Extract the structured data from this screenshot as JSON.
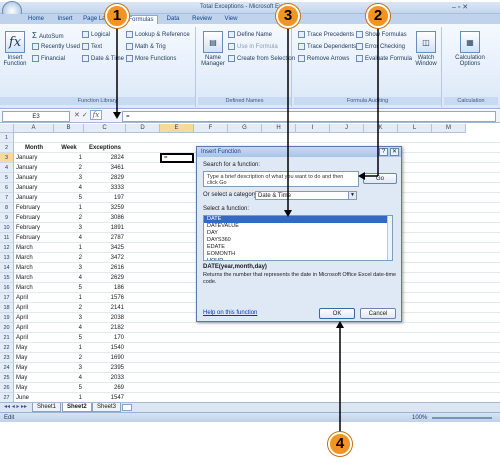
{
  "window": {
    "title": "Total Exceptions - Microsoft Excel"
  },
  "ribbon_tabs": [
    "Home",
    "Insert",
    "Page Layout",
    "Formulas",
    "Data",
    "Review",
    "View"
  ],
  "active_tab": "Formulas",
  "ribbon": {
    "insert_function": "Insert Function",
    "library": {
      "autosum": "AutoSum",
      "recently_used": "Recently Used",
      "financial": "Financial",
      "logical": "Logical",
      "text": "Text",
      "date_time": "Date & Time",
      "lookup": "Lookup & Reference",
      "math": "Math & Trig",
      "more": "More Functions",
      "label": "Function Library"
    },
    "names": {
      "manager": "Name Manager",
      "define": "Define Name",
      "use_in_formula": "Use in Formula",
      "create": "Create from Selection",
      "label": "Defined Names"
    },
    "auditing": {
      "trace_precedents": "Trace Precedents",
      "trace_dependents": "Trace Dependents",
      "remove_arrows": "Remove Arrows",
      "show_formulas": "Show Formulas",
      "error_checking": "Error Checking",
      "evaluate": "Evaluate Formula",
      "watch": "Watch Window",
      "label": "Formula Auditing"
    },
    "calculation": {
      "options": "Calculation Options",
      "label": "Calculation"
    }
  },
  "formula_bar": {
    "name_box": "E3",
    "content": "="
  },
  "columns": [
    "A",
    "B",
    "C",
    "D",
    "E",
    "F",
    "G",
    "H",
    "I",
    "J",
    "K",
    "L",
    "M"
  ],
  "headers": {
    "month": "Month",
    "week": "Week",
    "exceptions": "Exceptions"
  },
  "rows": [
    [
      "January",
      "1",
      "2824"
    ],
    [
      "January",
      "2",
      "3461"
    ],
    [
      "January",
      "3",
      "2829"
    ],
    [
      "January",
      "4",
      "3333"
    ],
    [
      "January",
      "5",
      "197"
    ],
    [
      "February",
      "1",
      "3259"
    ],
    [
      "February",
      "2",
      "3086"
    ],
    [
      "February",
      "3",
      "1891"
    ],
    [
      "February",
      "4",
      "2787"
    ],
    [
      "March",
      "1",
      "3425"
    ],
    [
      "March",
      "2",
      "3472"
    ],
    [
      "March",
      "3",
      "2616"
    ],
    [
      "March",
      "4",
      "2629"
    ],
    [
      "March",
      "5",
      "186"
    ],
    [
      "April",
      "1",
      "1576"
    ],
    [
      "April",
      "2",
      "2141"
    ],
    [
      "April",
      "3",
      "2038"
    ],
    [
      "April",
      "4",
      "2182"
    ],
    [
      "April",
      "5",
      "170"
    ],
    [
      "May",
      "1",
      "1540"
    ],
    [
      "May",
      "2",
      "1690"
    ],
    [
      "May",
      "3",
      "2395"
    ],
    [
      "May",
      "4",
      "2033"
    ],
    [
      "May",
      "5",
      "269"
    ],
    [
      "June",
      "1",
      "1547"
    ]
  ],
  "active_cell_value": "=",
  "sheets": [
    "Sheet1",
    "Sheet2",
    "Sheet3"
  ],
  "active_sheet": "Sheet2",
  "status": {
    "mode": "Edit",
    "zoom": "100%"
  },
  "dialog": {
    "title": "Insert Function",
    "search_label": "Search for a function:",
    "search_text": "Type a brief description of what you want to do and then click Go",
    "go": "Go",
    "category_label": "Or select a category:",
    "category": "Date & Time",
    "select_label": "Select a function:",
    "functions": [
      "DATE",
      "DATEVALUE",
      "DAY",
      "DAYS360",
      "EDATE",
      "EOMONTH",
      "HOUR"
    ],
    "selected": "DATE",
    "signature": "DATE(year,month,day)",
    "description": "Returns the number that represents the date in Microsoft Office Excel date-time code.",
    "help": "Help on this function",
    "ok": "OK",
    "cancel": "Cancel"
  },
  "callouts": [
    "1",
    "2",
    "3",
    "4"
  ],
  "colors": {
    "callout": "#f29421",
    "ribbon": "#dbe8f8",
    "selection": "#316ac5"
  }
}
